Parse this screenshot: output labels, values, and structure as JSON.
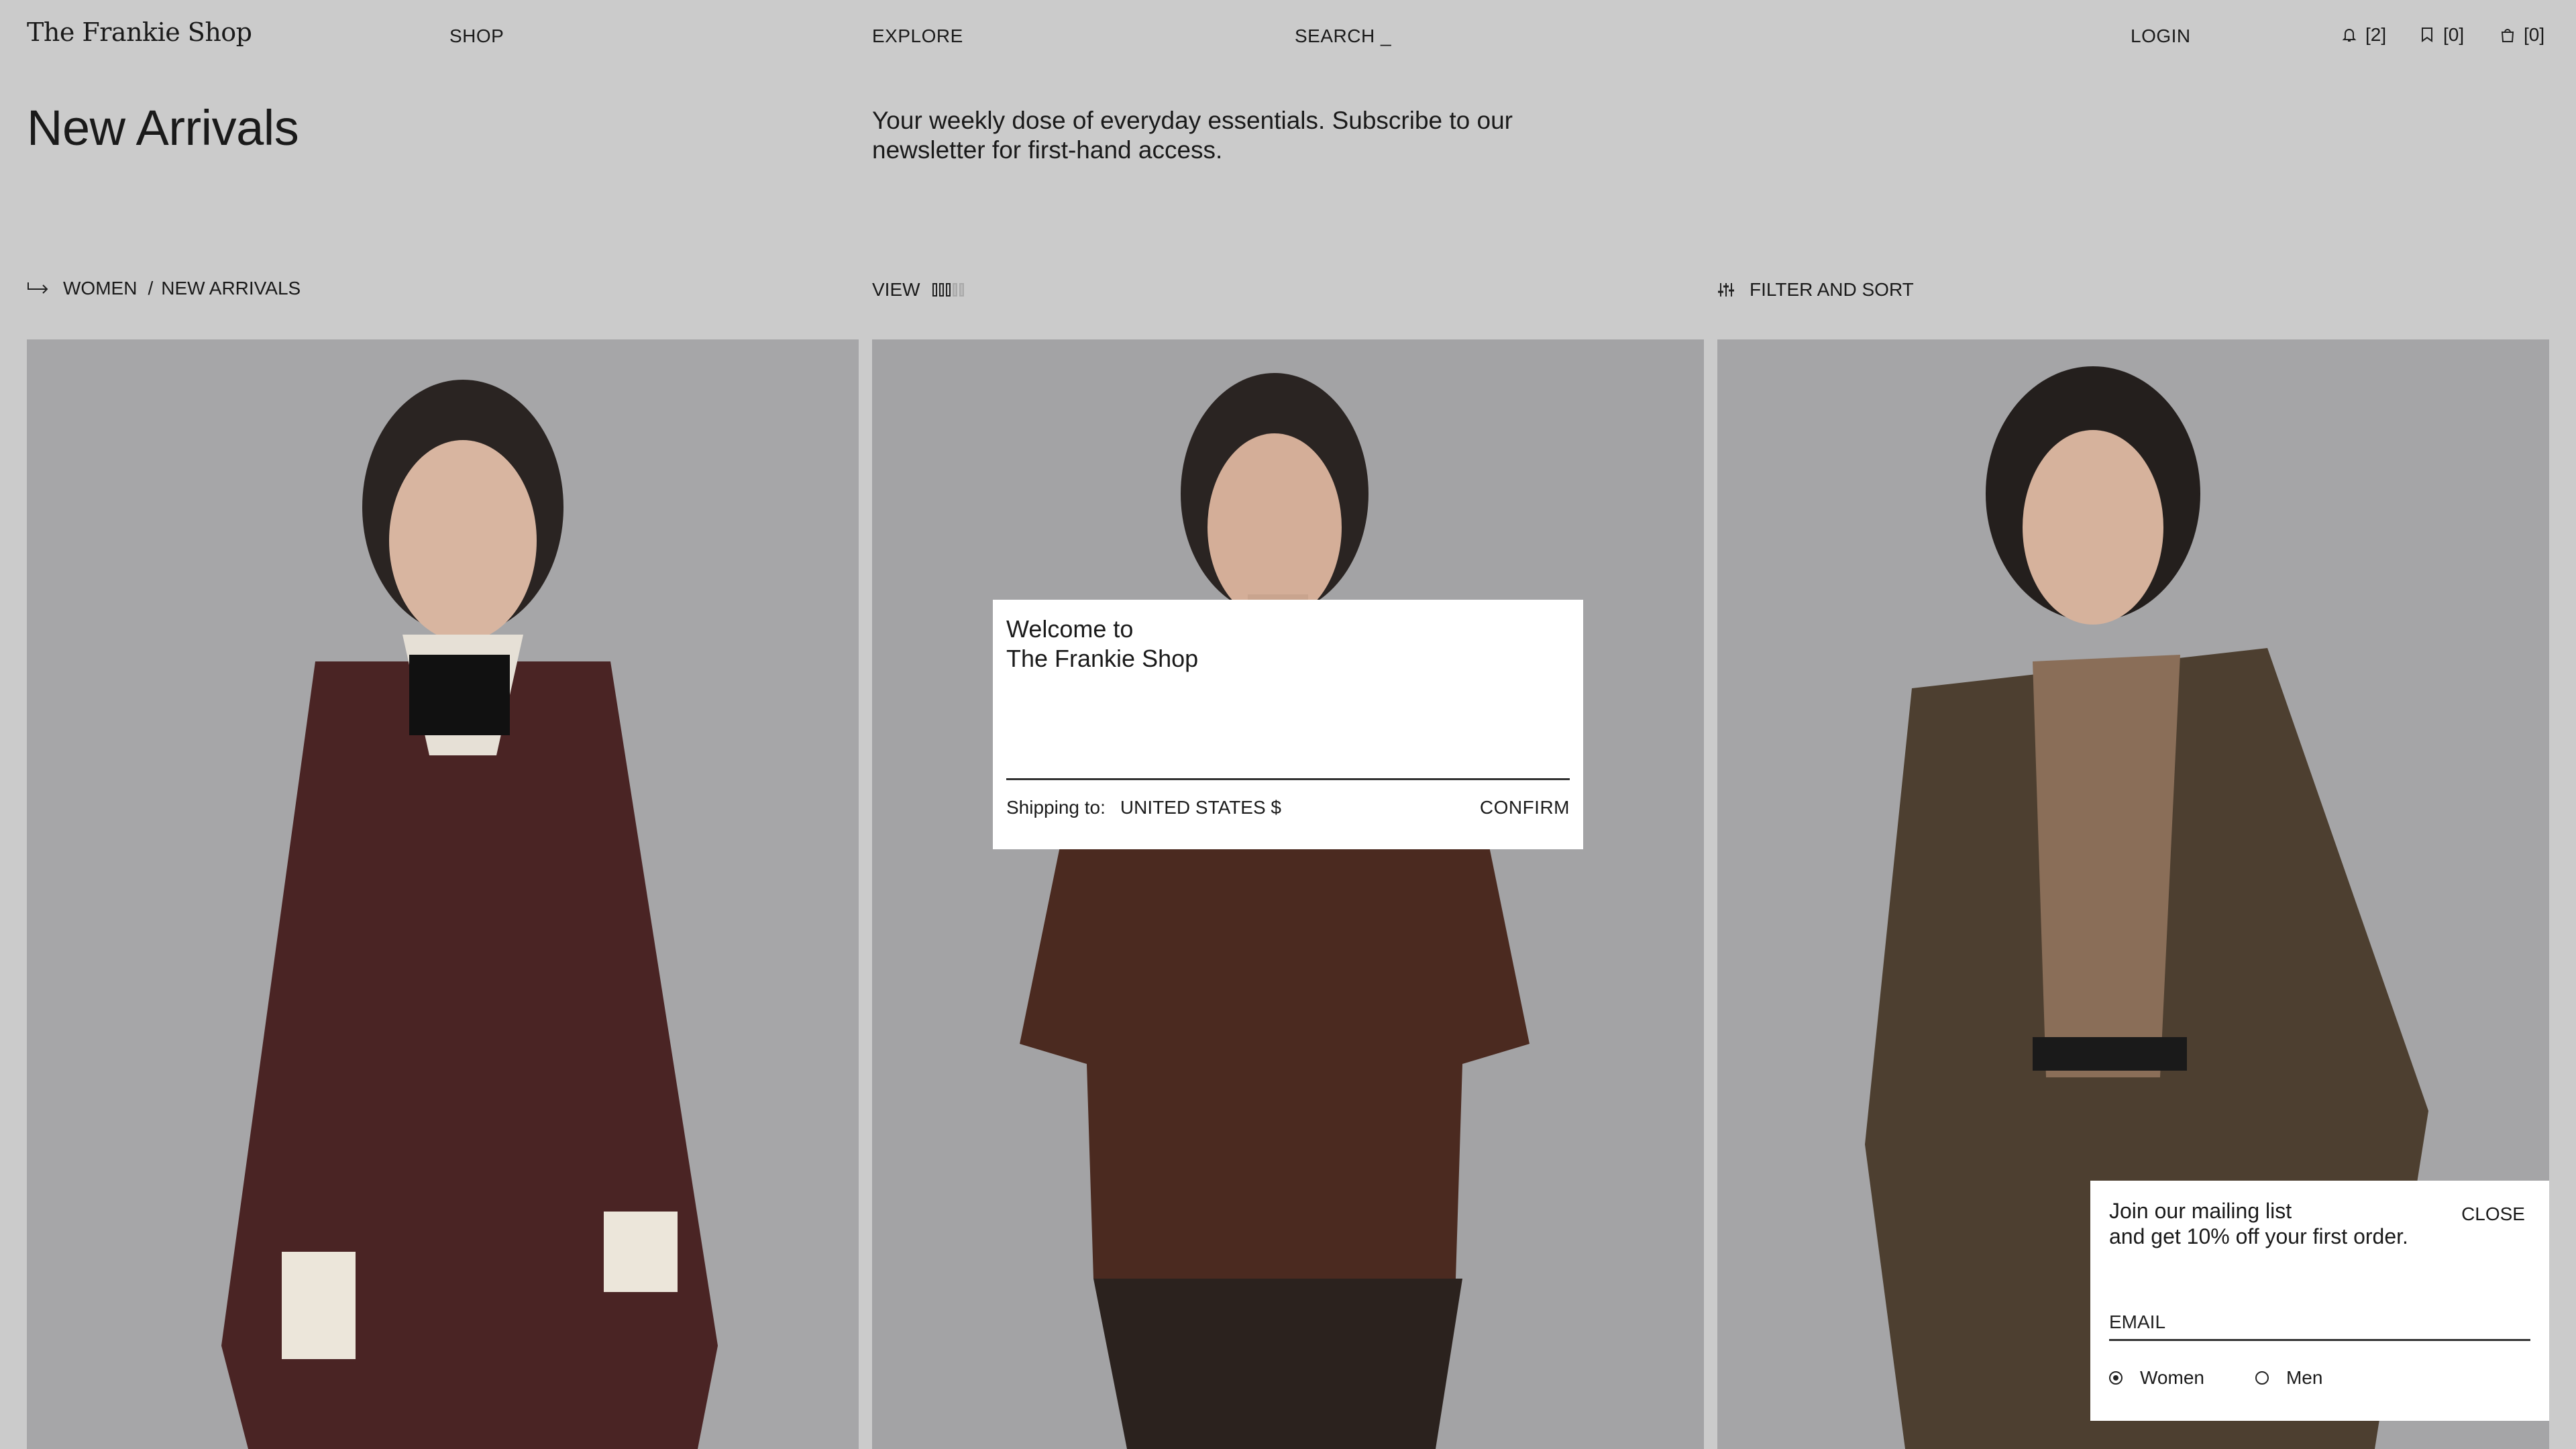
{
  "header": {
    "logo": "The Frankie Shop",
    "nav": {
      "shop": "SHOP",
      "explore": "EXPLORE",
      "search": "SEARCH _",
      "login": "LOGIN"
    },
    "notifications": "[2]",
    "wishlist": "[0]",
    "cart": "[0]"
  },
  "page": {
    "title": "New Arrivals",
    "tagline": "Your weekly dose of everyday essentials. Subscribe to our newsletter for first-hand access."
  },
  "toolbar": {
    "breadcrumb": [
      "WOMEN",
      "/",
      "NEW ARRIVALS"
    ],
    "view_label": "VIEW",
    "filter_label": "FILTER AND SORT"
  },
  "welcome_modal": {
    "title_line1": "Welcome to",
    "title_line2": "The Frankie Shop",
    "shipping_label": "Shipping to:",
    "country_value": "UNITED STATES $",
    "confirm_label": "CONFIRM"
  },
  "mailing_popup": {
    "line1": "Join our mailing list",
    "line2": "and get 10% off your first order.",
    "close_label": "CLOSE",
    "email_placeholder": "EMAIL",
    "options": [
      {
        "label": "Women",
        "selected": true
      },
      {
        "label": "Men",
        "selected": false
      }
    ]
  },
  "products": [
    {
      "image": "model-brown-trench-coat"
    },
    {
      "image": "model-brown-oversized-tee"
    },
    {
      "image": "model-olive-suede-blazer"
    }
  ],
  "colors": {
    "background": "#cbcbcb",
    "coat": "#4a2424",
    "tee": "#4b2a20",
    "blazer": "#4d3f30"
  }
}
